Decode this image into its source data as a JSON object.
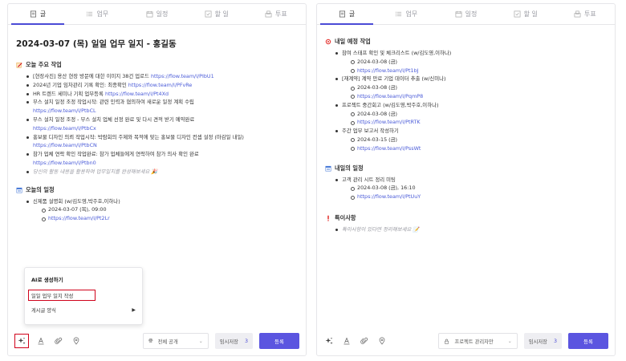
{
  "tabs": [
    {
      "label": "글",
      "icon": "document-icon"
    },
    {
      "label": "업무",
      "icon": "list-icon"
    },
    {
      "label": "일정",
      "icon": "calendar-icon"
    },
    {
      "label": "할 일",
      "icon": "checkbox-icon"
    },
    {
      "label": "투표",
      "icon": "vote-icon"
    }
  ],
  "left": {
    "title": "2024-03-07 (목) 일일 업무 일지 - 홍길동",
    "section1": {
      "title": "오늘 주요 작업",
      "items": [
        {
          "text": "[현장사진] 용산 현장 방문에 대한 이미지 38건 업로드 ",
          "link": "https://flow.team/l/PIbU1"
        },
        {
          "text": "2024년 기업 임차관리 기록 확인: 최종확인 ",
          "link": "https://flow.team/l/PFvRe"
        },
        {
          "text": "HR 트렌드 세미나 기획 업무등록 ",
          "link": "https://flow.team/l/Pt4Xd"
        },
        {
          "text": "부스 설치 일정 조정 작업시작: 관련 인력과 협의하여 새로운 일정 계획 수립 ",
          "link": "https://flow.team/l/PtbCL"
        },
        {
          "text": "부스 설치 일정 조정 - 부스 설치 업체 선정 완료 및 다시 견적 받기 예약완료 ",
          "link": "https://flow.team/l/PtbCx"
        },
        {
          "text": "홍보물 디자인 의뢰 작업시작: 박람회의 주제와 목적에 맞는 홍보물 디자인 컨셉 설정 (마감일 내일) ",
          "link": "https://flow.team/l/PtbCN"
        },
        {
          "text": "참가 업체 연락 확인 작업완료: 참가 업체들에게 연락하여 참가 의사 확인 완료 ",
          "link": "https://flow.team/l/Ptbn0"
        }
      ],
      "hint": "당신의 활동 내용을 활용하여 업무일지를 완성해보세요 🎉"
    },
    "section2": {
      "title": "오늘의 일정",
      "item": "신제품 설명회 (w/김도영,박주호,이하나)",
      "date": "2024-03-07 (목), 09:00",
      "link": "https://flow.team/l/Pt2Lr"
    },
    "popup": {
      "title": "AI로 생성하기",
      "item1": "일일 업무 일지 작성",
      "item2": "게시글 양식"
    },
    "scope": "전체 공개",
    "draft": "임시저장",
    "draft_count": "3",
    "submit": "등록"
  },
  "right": {
    "section1": {
      "title": "내일 예정 작업",
      "items": [
        {
          "text": "참여 스태프 확인 및 체크리스트 (w/김도영,이하나)",
          "date": "2024-03-08 (금)",
          "link": "https://flow.team/l/Pt1bJ"
        },
        {
          "text": "[재계약] 계약 만료 기업 데이터 추출 (w/신미나)",
          "date": "2024-03-08 (금)",
          "link": "https://flow.team/l/PqmP8"
        },
        {
          "text": "프로젝트 중간회고 (w/김도영,박주호,이하나)",
          "date": "2024-03-08 (금)",
          "link": "https://flow.team/l/PtRTK"
        },
        {
          "text": "주간 업무 보고서 작성하기",
          "date": "2024-03-15 (금)",
          "link": "https://flow.team/l/PssWt"
        }
      ]
    },
    "section2": {
      "title": "내일의 일정",
      "item": "고객 관리 시트 정리 미팅",
      "date": "2024-03-08 (금), 16:10",
      "link": "https://flow.team/l/PtUuY"
    },
    "section3": {
      "title": "특이사항",
      "hint": "특이사항이 있다면 정리해보세요 📝"
    },
    "scope": "프로젝트 관리자만",
    "draft": "임시저장",
    "draft_count": "3",
    "submit": "등록"
  }
}
